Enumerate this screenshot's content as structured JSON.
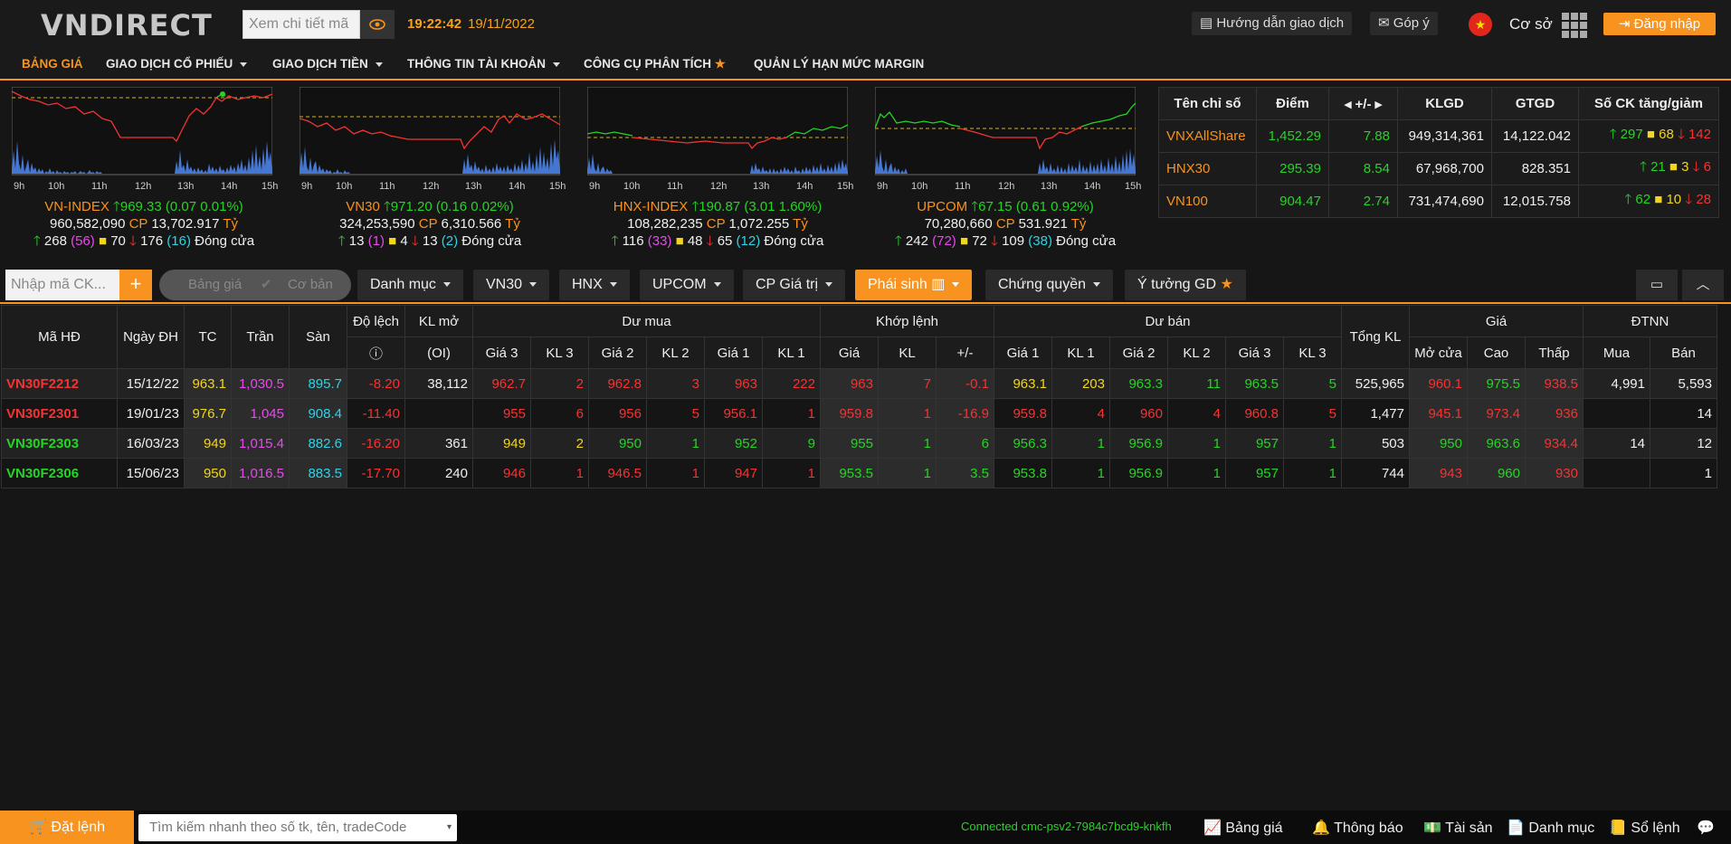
{
  "header": {
    "logo": "VNDIRECT",
    "search_placeholder": "Xem chi tiết mã",
    "time": "19:22:42",
    "date": "19/11/2022",
    "guide": "Hướng dẫn giao dịch",
    "feedback": "Góp ý",
    "mode": "Cơ sở",
    "login": "Đăng nhập"
  },
  "nav": [
    "BẢNG GIÁ",
    "GIAO DỊCH CỔ PHIẾU",
    "GIAO DỊCH TIỀN",
    "THÔNG TIN TÀI KHOẢN",
    "CÔNG CỤ PHÂN TÍCH",
    "QUẢN LÝ HẠN MỨC MARGIN"
  ],
  "hours": [
    "9h",
    "10h",
    "11h",
    "12h",
    "13h",
    "14h",
    "15h"
  ],
  "indices": [
    {
      "name": "VN-INDEX",
      "value": "969.33",
      "chg": "(0.07 0.01%)",
      "vol": "960,582,090",
      "cp": "CP",
      "val": "13,702.917",
      "unit": "Tỷ",
      "up": "268",
      "upc": "(56)",
      "ref": "70",
      "down": "176",
      "downc": "(16)",
      "status": "Đóng cửa"
    },
    {
      "name": "VN30",
      "value": "971.20",
      "chg": "(0.16 0.02%)",
      "vol": "324,253,590",
      "cp": "CP",
      "val": "6,310.566",
      "unit": "Tỷ",
      "up": "13",
      "upc": "(1)",
      "ref": "4",
      "down": "13",
      "downc": "(2)",
      "status": "Đóng cửa"
    },
    {
      "name": "HNX-INDEX",
      "value": "190.87",
      "chg": "(3.01 1.60%)",
      "vol": "108,282,235",
      "cp": "CP",
      "val": "1,072.255",
      "unit": "Tỷ",
      "up": "116",
      "upc": "(33)",
      "ref": "48",
      "down": "65",
      "downc": "(12)",
      "status": "Đóng cửa"
    },
    {
      "name": "UPCOM",
      "value": "67.15",
      "chg": "(0.61 0.92%)",
      "vol": "70,280,660",
      "cp": "CP",
      "val": "531.921",
      "unit": "Tỷ",
      "up": "242",
      "upc": "(72)",
      "ref": "72",
      "down": "109",
      "downc": "(38)",
      "status": "Đóng cửa"
    }
  ],
  "summary": {
    "headers": [
      "Tên chỉ số",
      "Điểm",
      "+/-",
      "KLGD",
      "GTGD",
      "Số CK tăng/giảm"
    ],
    "rows": [
      {
        "name": "VNXAllShare",
        "point": "1,452.29",
        "chg": "7.88",
        "klgd": "949,314,361",
        "gtgd": "14,122.042",
        "up": "297",
        "ref": "68",
        "down": "142"
      },
      {
        "name": "HNX30",
        "point": "295.39",
        "chg": "8.54",
        "klgd": "67,968,700",
        "gtgd": "828.351",
        "up": "21",
        "ref": "3",
        "down": "6"
      },
      {
        "name": "VN100",
        "point": "904.47",
        "chg": "2.74",
        "klgd": "731,474,690",
        "gtgd": "12,015.758",
        "up": "62",
        "ref": "10",
        "down": "28"
      }
    ]
  },
  "toolbar": {
    "input_placeholder": "Nhập mã CK...",
    "plus": "+",
    "toggle1": "Bảng giá",
    "toggle2": "Cơ bản",
    "tabs": [
      "Danh mục",
      "VN30",
      "HNX",
      "UPCOM",
      "CP Giá trị",
      "Phái sinh",
      "Chứng quyền",
      "Ý tưởng GD"
    ]
  },
  "table": {
    "h1": [
      "Mã HĐ",
      "Ngày ĐH",
      "TC",
      "Trần",
      "Sàn",
      "Độ lệch",
      "KL mở",
      "Dư mua",
      "Khớp lệnh",
      "Dư bán",
      "Tổng KL",
      "Giá",
      "ĐTNN"
    ],
    "h2": [
      "(OI)",
      "Giá 3",
      "KL 3",
      "Giá 2",
      "KL 2",
      "Giá 1",
      "KL 1",
      "Giá",
      "KL",
      "+/-",
      "Giá 1",
      "KL 1",
      "Giá 2",
      "KL 2",
      "Giá 3",
      "KL 3",
      "Mở cửa",
      "Cao",
      "Thấp",
      "Mua",
      "Bán"
    ],
    "rows": [
      {
        "code": "VN30F2212",
        "date": "15/12/22",
        "tc": "963.1",
        "tran": "1,030.5",
        "san": "895.7",
        "dl": "-8.20",
        "oi": "38,112",
        "b3": "962.7",
        "bk3": "2",
        "b2": "962.8",
        "bk2": "3",
        "b1": "963",
        "bk1": "222",
        "mp": "963",
        "mk": "7",
        "mc": "-0.1",
        "s1": "963.1",
        "sk1": "203",
        "s2": "963.3",
        "sk2": "11",
        "s3": "963.5",
        "sk3": "5",
        "tot": "525,965",
        "op": "960.1",
        "hi": "975.5",
        "lo": "938.5",
        "fb": "4,991",
        "fs": "5,593"
      },
      {
        "code": "VN30F2301",
        "date": "19/01/23",
        "tc": "976.7",
        "tran": "1,045",
        "san": "908.4",
        "dl": "-11.40",
        "oi": "",
        "b3": "955",
        "bk3": "6",
        "b2": "956",
        "bk2": "5",
        "b1": "956.1",
        "bk1": "1",
        "mp": "959.8",
        "mk": "1",
        "mc": "-16.9",
        "s1": "959.8",
        "sk1": "4",
        "s2": "960",
        "sk2": "4",
        "s3": "960.8",
        "sk3": "5",
        "tot": "1,477",
        "op": "945.1",
        "hi": "973.4",
        "lo": "936",
        "fb": "",
        "fs": "14"
      },
      {
        "code": "VN30F2303",
        "date": "16/03/23",
        "tc": "949",
        "tran": "1,015.4",
        "san": "882.6",
        "dl": "-16.20",
        "oi": "361",
        "b3": "949",
        "bk3": "2",
        "b2": "950",
        "bk2": "1",
        "b1": "952",
        "bk1": "9",
        "mp": "955",
        "mk": "1",
        "mc": "6",
        "s1": "956.3",
        "sk1": "1",
        "s2": "956.9",
        "sk2": "1",
        "s3": "957",
        "sk3": "1",
        "tot": "503",
        "op": "950",
        "hi": "963.6",
        "lo": "934.4",
        "fb": "14",
        "fs": "12"
      },
      {
        "code": "VN30F2306",
        "date": "15/06/23",
        "tc": "950",
        "tran": "1,016.5",
        "san": "883.5",
        "dl": "-17.70",
        "oi": "240",
        "b3": "946",
        "bk3": "1",
        "b2": "946.5",
        "bk2": "1",
        "b1": "947",
        "bk1": "1",
        "mp": "953.5",
        "mk": "1",
        "mc": "3.5",
        "s1": "953.8",
        "sk1": "1",
        "s2": "956.9",
        "sk2": "1",
        "s3": "957",
        "sk3": "1",
        "tot": "744",
        "op": "943",
        "hi": "960",
        "lo": "930",
        "fb": "",
        "fs": "1"
      }
    ]
  },
  "footer": {
    "order": "Đặt lệnh",
    "search_placeholder": "Tìm kiếm nhanh theo số tk, tên, tradeCode",
    "connected": "Connected cmc-psv2-7984c7bcd9-knkfh",
    "items": [
      "Bảng giá",
      "Thông báo",
      "Tài sản",
      "Danh mục",
      "Sổ lệnh"
    ]
  }
}
